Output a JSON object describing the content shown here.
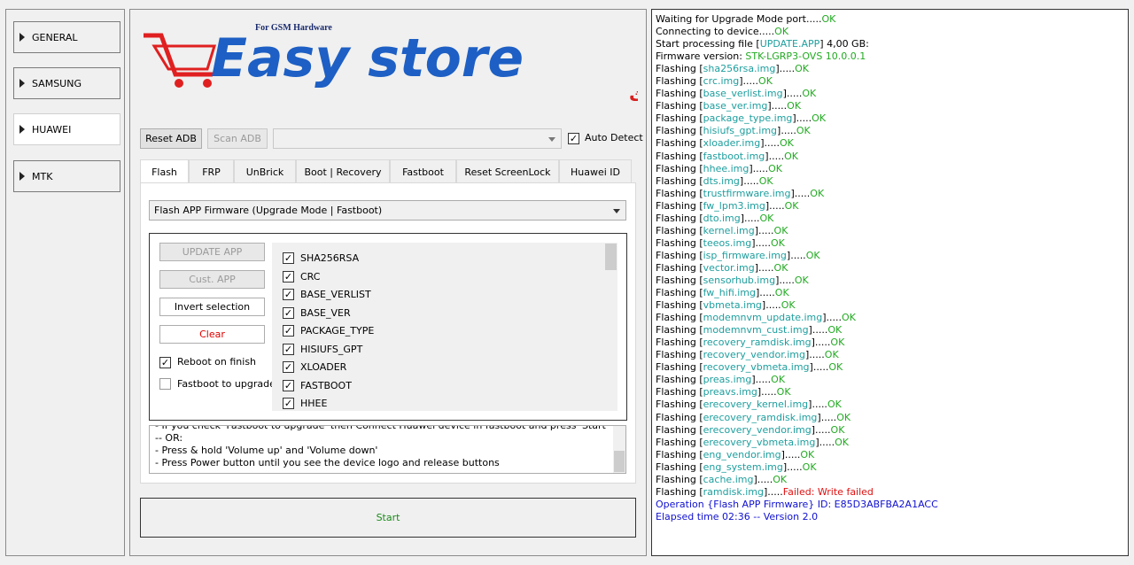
{
  "nav": {
    "items": [
      {
        "label": "GENERAL"
      },
      {
        "label": "SAMSUNG"
      },
      {
        "label": "HUAWEI"
      },
      {
        "label": "MTK"
      }
    ]
  },
  "logo": {
    "top_text": "For GSM Hardware",
    "brand": "Easy store",
    "arabic": "ايزي ستور- العراق / دهوك / سوق مربع طابق الثالث"
  },
  "toolbar": {
    "reset_adb": "Reset ADB",
    "scan_adb": "Scan ADB",
    "auto_detect": "Auto Detect"
  },
  "tabs": [
    "Flash",
    "FRP",
    "UnBrick",
    "Boot | Recovery",
    "Fastboot",
    "Reset ScreenLock",
    "Huawei ID"
  ],
  "flash": {
    "mode": "Flash APP Firmware (Upgrade Mode | Fastboot)",
    "update_app": "UPDATE APP",
    "cust_app": "Cust. APP",
    "invert_selection": "Invert selection",
    "clear": "Clear",
    "reboot_on_finish": "Reboot on finish",
    "fastboot_to_upgrade": "Fastboot to upgrade",
    "partitions": [
      "SHA256RSA",
      "CRC",
      "BASE_VERLIST",
      "BASE_VER",
      "PACKAGE_TYPE",
      "HISIUFS_GPT",
      "XLOADER",
      "FASTBOOT",
      "HHEE"
    ],
    "info_lines": [
      "- If you check 'Fastboot to upgrade' then Connect Huawei device in fastboot and press 'Start'",
      "-- OR:",
      "- Press & hold 'Volume up' and 'Volume down'",
      "- Press Power button until you see the device logo and release buttons"
    ],
    "start": "Start"
  },
  "log": {
    "header": [
      {
        "text": "Waiting for Upgrade Mode port.....",
        "status": "OK"
      },
      {
        "text": "Connecting to device.....",
        "status": "OK"
      }
    ],
    "processing_prefix": "Start processing file [",
    "processing_file": "UPDATE.APP",
    "processing_suffix": "] 4,00 GB:",
    "firmware_label": "Firmware version: ",
    "firmware_value": "STK-LGRP3-OVS 10.0.0.1",
    "flash_prefix": "Flashing [",
    "flash_mid": "].....",
    "ok": "OK",
    "files": [
      "sha256rsa.img",
      "crc.img",
      "base_verlist.img",
      "base_ver.img",
      "package_type.img",
      "hisiufs_gpt.img",
      "xloader.img",
      "fastboot.img",
      "hhee.img",
      "dts.img",
      "trustfirmware.img",
      "fw_lpm3.img",
      "dto.img",
      "kernel.img",
      "teeos.img",
      "isp_firmware.img",
      "vector.img",
      "sensorhub.img",
      "fw_hifi.img",
      "vbmeta.img",
      "modemnvm_update.img",
      "modemnvm_cust.img",
      "recovery_ramdisk.img",
      "recovery_vendor.img",
      "recovery_vbmeta.img",
      "preas.img",
      "preavs.img",
      "erecovery_kernel.img",
      "erecovery_ramdisk.img",
      "erecovery_vendor.img",
      "erecovery_vbmeta.img",
      "eng_vendor.img",
      "eng_system.img",
      "cache.img"
    ],
    "failed_file": "ramdisk.img",
    "failed_status": "Failed: Write failed",
    "operation": "Operation {Flash APP Firmware} ID: E85D3ABFBA2A1ACC",
    "elapsed": "Elapsed time 02:36 -- Version 2.0",
    "colors": {
      "ok": "#22aa22",
      "file": "#1e9e9e",
      "fail": "#e01010",
      "info": "#1010d0"
    }
  }
}
